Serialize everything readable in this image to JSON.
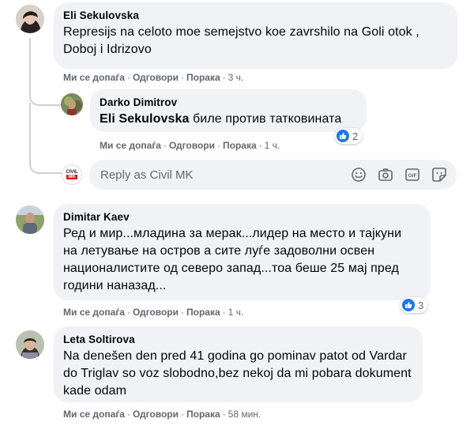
{
  "comments": [
    {
      "author": "Eli Sekulovska",
      "text": "Represijs na celoto moe semejstvo koe zavrshilo na Goli otok , Doboj i Idrizovo",
      "actions": {
        "like": "Ми се допаѓа",
        "reply": "Одговори",
        "message": "Порака"
      },
      "time": "3 ч.",
      "reply": {
        "author": "Darko Dimitrov",
        "mention": "Eli Sekulovska",
        "text": "биле против татковината",
        "actions": {
          "like": "Ми се допаѓа",
          "reply": "Одговори",
          "message": "Порака"
        },
        "time": "1 ч.",
        "reaction_count": "2"
      },
      "reply_input": {
        "avatar_label_top": "CIVIL",
        "avatar_label_bottom": "MK",
        "placeholder": "Reply as Civil MK",
        "icons": [
          "emoji-icon",
          "camera-icon",
          "gif-icon",
          "sticker-icon"
        ]
      }
    },
    {
      "author": "Dimitar Kaev",
      "text": "Ред и мир...младина за мерак...лидер на место и тајкуни на летување на остров а сите луѓе задоволни освен националистите од северо запад...тоа беше 25 мај пред години наназад...",
      "actions": {
        "like": "Ми се допаѓа",
        "reply": "Одговори",
        "message": "Порака"
      },
      "time": "1 ч.",
      "reaction_count": "3"
    },
    {
      "author": "Leta Soltirova",
      "text": "Na denešen den pred 41 godina go pominav patot od Vardar do Triglav so voz slobodno,bez nekoj da mi pobara dokument kade odam",
      "actions": {
        "like": "Ми се допаѓа",
        "reply": "Одговори",
        "message": "Порака"
      },
      "time": "58 мин."
    }
  ],
  "colors": {
    "bubble": "#f0f2f5",
    "meta": "#65676b",
    "like": "#1877f2",
    "text": "#050505"
  }
}
